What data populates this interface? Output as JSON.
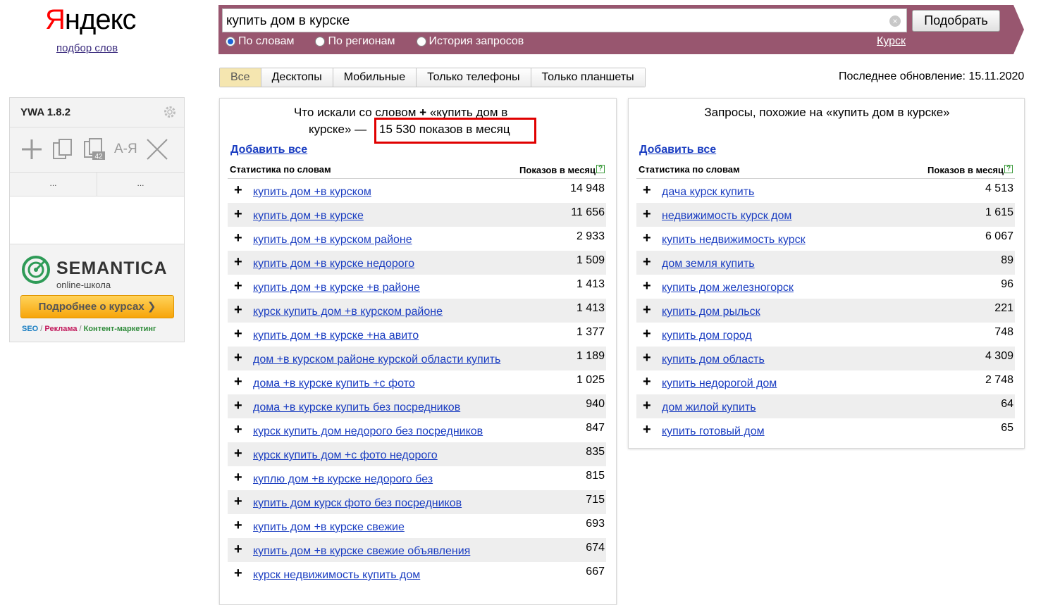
{
  "logo": {
    "text_first": "Я",
    "text_rest": "ндекс",
    "subtitle": "подбор слов"
  },
  "search": {
    "query": "купить дом в курске",
    "clear_glyph": "×",
    "submit_label": "Подобрать",
    "modes": [
      {
        "label": "По словам",
        "selected": true
      },
      {
        "label": "По регионам",
        "selected": false
      },
      {
        "label": "История запросов",
        "selected": false
      }
    ],
    "region": "Курск"
  },
  "colors": {
    "band": "#98566f",
    "link": "#1a3dc1",
    "highlight": "#e00000",
    "tab_active": "#f5e6b0"
  },
  "tabs": [
    {
      "label": "Все",
      "active": true
    },
    {
      "label": "Десктопы",
      "active": false
    },
    {
      "label": "Мобильные",
      "active": false
    },
    {
      "label": "Только телефоны",
      "active": false
    },
    {
      "label": "Только планшеты",
      "active": false
    }
  ],
  "last_update": "Последнее обновление: 15.11.2020",
  "ywa": {
    "title": "YWA 1.8.2",
    "icons": [
      "gear-icon",
      "plus-icon",
      "copy-icon",
      "copy-count-icon",
      "sort-az-icon",
      "close-icon"
    ],
    "copy_count": "42",
    "sort_label": "А-Я",
    "dots_left": "...",
    "dots_right": "...",
    "promo": {
      "name": "SEMANTICA",
      "sub": "online-школа",
      "button": "Подробнее о курсах ❯",
      "tag1": "SEO",
      "sep": " / ",
      "tag2": "Реклама",
      "tag3": "Контент-маркетинг"
    }
  },
  "left_panel": {
    "title_line1": "Что искали со словом",
    "title_plus": "+",
    "title_line1b": "«купить дом в",
    "title_line2": "курске» —",
    "highlight": "15 530 показов в месяц",
    "add_all": "Добавить все",
    "col_keyword": "Статистика по словам",
    "col_count": "Показов в месяц",
    "help": "?",
    "rows": [
      {
        "kw": "купить дом +в курском",
        "cnt": "14 948"
      },
      {
        "kw": "купить дом +в курске",
        "cnt": "11 656"
      },
      {
        "kw": "купить дом +в курском районе",
        "cnt": "2 933"
      },
      {
        "kw": "купить дом +в курске недорого",
        "cnt": "1 509"
      },
      {
        "kw": "купить дом +в курске +в районе",
        "cnt": "1 413"
      },
      {
        "kw": "курск купить дом +в курском районе",
        "cnt": "1 413"
      },
      {
        "kw": "купить дом +в курске +на авито",
        "cnt": "1 377"
      },
      {
        "kw": "дом +в курском районе курской области купить",
        "cnt": "1 189"
      },
      {
        "kw": "дома +в курске купить +с фото",
        "cnt": "1 025"
      },
      {
        "kw": "дома +в курске купить без посредников",
        "cnt": "940"
      },
      {
        "kw": "курск купить дом недорого без посредников",
        "cnt": "847"
      },
      {
        "kw": "курск купить дом +с фото недорого",
        "cnt": "835"
      },
      {
        "kw": "куплю дом +в курске недорого без",
        "cnt": "815"
      },
      {
        "kw": "купить дом курск фото без посредников",
        "cnt": "715"
      },
      {
        "kw": "купить дом +в курске свежие",
        "cnt": "693"
      },
      {
        "kw": "купить дом +в курске свежие объявления",
        "cnt": "674"
      },
      {
        "kw": "курск недвижимость купить дом",
        "cnt": "667"
      }
    ]
  },
  "right_panel": {
    "title": "Запросы, похожие на «купить дом в курске»",
    "add_all": "Добавить все",
    "col_keyword": "Статистика по словам",
    "col_count": "Показов в месяц",
    "help": "?",
    "rows": [
      {
        "kw": "дача курск купить",
        "cnt": "4 513"
      },
      {
        "kw": "недвижимость курск дом",
        "cnt": "1 615"
      },
      {
        "kw": "купить недвижимость курск",
        "cnt": "6 067"
      },
      {
        "kw": "дом земля купить",
        "cnt": "89"
      },
      {
        "kw": "купить дом железногорск",
        "cnt": "96"
      },
      {
        "kw": "купить дом рыльск",
        "cnt": "221"
      },
      {
        "kw": "купить дом город",
        "cnt": "748"
      },
      {
        "kw": "купить дом область",
        "cnt": "4 309"
      },
      {
        "kw": "купить недорогой дом",
        "cnt": "2 748"
      },
      {
        "kw": "дом жилой купить",
        "cnt": "64"
      },
      {
        "kw": "купить готовый дом",
        "cnt": "65"
      }
    ]
  }
}
